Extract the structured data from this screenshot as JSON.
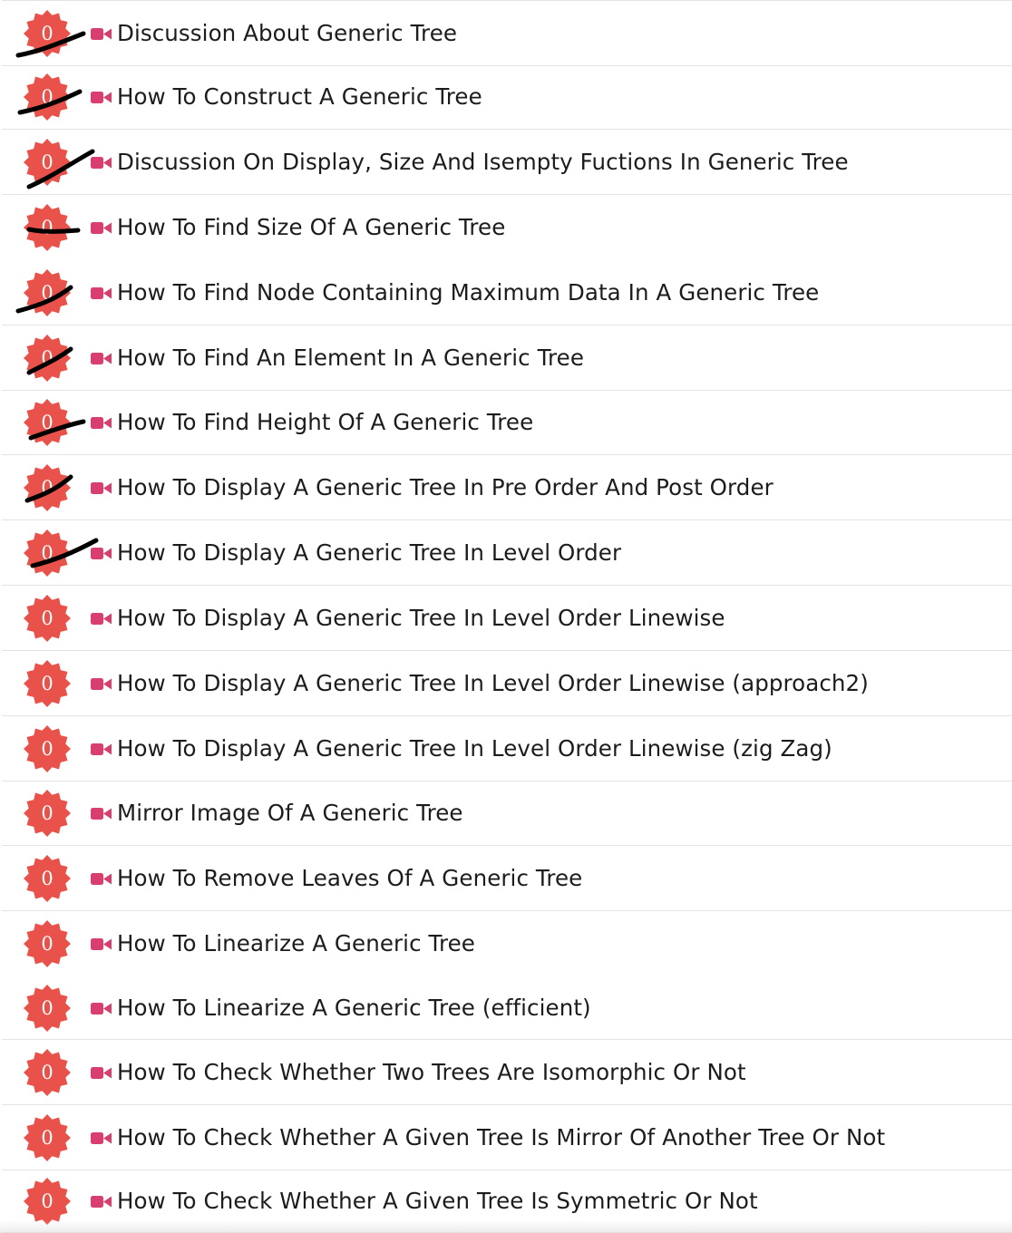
{
  "lecture_list": {
    "items": [
      {
        "label": "Discussion About Generic Tree",
        "badge_count": "0",
        "video_icon": "video-camera-icon",
        "struck": true
      },
      {
        "label": "How To Construct A Generic Tree",
        "badge_count": "0",
        "video_icon": "video-camera-icon",
        "struck": true
      },
      {
        "label": "Discussion On Display, Size And Isempty Fuctions In Generic Tree",
        "badge_count": "0",
        "video_icon": "video-camera-icon",
        "struck": true
      },
      {
        "label": "How To Find Size Of A Generic Tree",
        "badge_count": "0",
        "video_icon": "video-camera-icon",
        "struck": true
      },
      {
        "label": "How To Find Node Containing Maximum Data In A Generic Tree",
        "badge_count": "0",
        "video_icon": "video-camera-icon",
        "struck": true
      },
      {
        "label": "How To Find An Element In A Generic Tree",
        "badge_count": "0",
        "video_icon": "video-camera-icon",
        "struck": true
      },
      {
        "label": "How To Find Height Of A Generic Tree",
        "badge_count": "0",
        "video_icon": "video-camera-icon",
        "struck": true
      },
      {
        "label": "How To Display A Generic Tree In Pre Order And Post Order",
        "badge_count": "0",
        "video_icon": "video-camera-icon",
        "struck": true
      },
      {
        "label": "How To Display A Generic Tree In Level Order",
        "badge_count": "0",
        "video_icon": "video-camera-icon",
        "struck": true
      },
      {
        "label": "How To Display A Generic Tree In Level Order Linewise",
        "badge_count": "0",
        "video_icon": "video-camera-icon",
        "struck": false
      },
      {
        "label": "How To Display A Generic Tree In Level Order Linewise (approach2)",
        "badge_count": "0",
        "video_icon": "video-camera-icon",
        "struck": false
      },
      {
        "label": "How To Display A Generic Tree In Level Order Linewise (zig Zag)",
        "badge_count": "0",
        "video_icon": "video-camera-icon",
        "struck": false
      },
      {
        "label": "Mirror Image Of A Generic Tree",
        "badge_count": "0",
        "video_icon": "video-camera-icon",
        "struck": false
      },
      {
        "label": "How To Remove Leaves Of A Generic Tree",
        "badge_count": "0",
        "video_icon": "video-camera-icon",
        "struck": false
      },
      {
        "label": "How To Linearize A Generic Tree",
        "badge_count": "0",
        "video_icon": "video-camera-icon",
        "struck": false
      },
      {
        "label": "How To Linearize A Generic Tree (efficient)",
        "badge_count": "0",
        "video_icon": "video-camera-icon",
        "struck": false
      },
      {
        "label": "How To Check Whether Two Trees Are Isomorphic Or Not",
        "badge_count": "0",
        "video_icon": "video-camera-icon",
        "struck": false
      },
      {
        "label": "How To Check Whether A Given Tree Is Mirror Of Another Tree Or Not",
        "badge_count": "0",
        "video_icon": "video-camera-icon",
        "struck": false
      },
      {
        "label": "How To Check Whether A Given Tree Is Symmetric Or Not",
        "badge_count": "0",
        "video_icon": "video-camera-icon",
        "struck": false
      }
    ]
  },
  "colors": {
    "badge": "#e8524a",
    "video_icon": "#d83f6f",
    "text": "#1c1c1c",
    "divider": "#e4e4e4",
    "ink": "#000000"
  }
}
